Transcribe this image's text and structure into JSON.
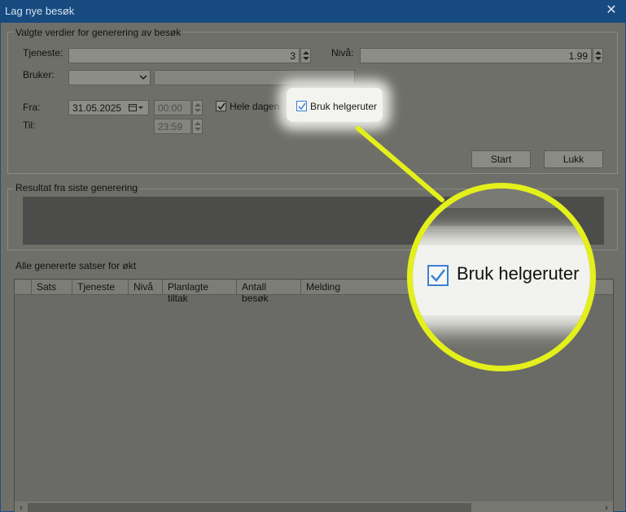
{
  "window": {
    "title": "Lag nye besøk",
    "close_glyph": "✕"
  },
  "generation": {
    "group_label": "Valgte verdier for generering av besøk",
    "tjeneste_label": "Tjeneste:",
    "tjeneste_value": "3",
    "niva_label": "Nivå:",
    "niva_value": "1.99",
    "bruker_label": "Bruker:",
    "bruker_value": "",
    "bruker_text": "",
    "fra_label": "Fra:",
    "fra_date": "31.05.2025",
    "fra_time": "00:00",
    "til_label": "Til:",
    "til_time": "23:59",
    "hele_dagen_label": "Hele dagen",
    "hele_dagen_checked": true,
    "bruk_helgeruter_label": "Bruk helgeruter",
    "bruk_helgeruter_checked": true,
    "start_label": "Start",
    "lukk_label": "Lukk"
  },
  "result": {
    "group_label": "Resultat fra siste generering"
  },
  "sets": {
    "group_label": "Alle genererte satser for økt",
    "columns": [
      "",
      "Sats",
      "Tjeneste",
      "Nivå",
      "Planlagte tiltak",
      "Antall besøk",
      "Melding"
    ]
  },
  "magnifier": {
    "label": "Bruk helgeruter"
  },
  "colors": {
    "highlight": "#e4f01b",
    "checkbox_accent": "#3b7fd4"
  },
  "icons": [
    "close-icon",
    "calendar-icon",
    "chevron-down-icon",
    "spin-up-icon",
    "spin-down-icon",
    "check-icon",
    "scroll-left-icon",
    "scroll-right-icon"
  ]
}
